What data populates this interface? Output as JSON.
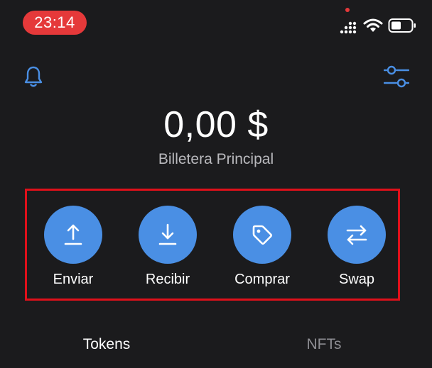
{
  "status_bar": {
    "time": "23:14"
  },
  "icons": {
    "bell": "bell-icon",
    "settings": "sliders-icon",
    "send": "arrow-up-icon",
    "receive": "arrow-down-icon",
    "buy": "tag-icon",
    "swap": "swap-arrows-icon"
  },
  "wallet": {
    "balance": "0,00 $",
    "name": "Billetera Principal"
  },
  "actions": [
    {
      "label": "Enviar"
    },
    {
      "label": "Recibir"
    },
    {
      "label": "Comprar"
    },
    {
      "label": "Swap"
    }
  ],
  "tabs": [
    {
      "label": "Tokens",
      "active": true
    },
    {
      "label": "NFTs",
      "active": false
    }
  ],
  "colors": {
    "background": "#1b1b1d",
    "accent": "#4a8fe4",
    "time_pill": "#e5393a",
    "highlight_frame": "#e0101a"
  }
}
